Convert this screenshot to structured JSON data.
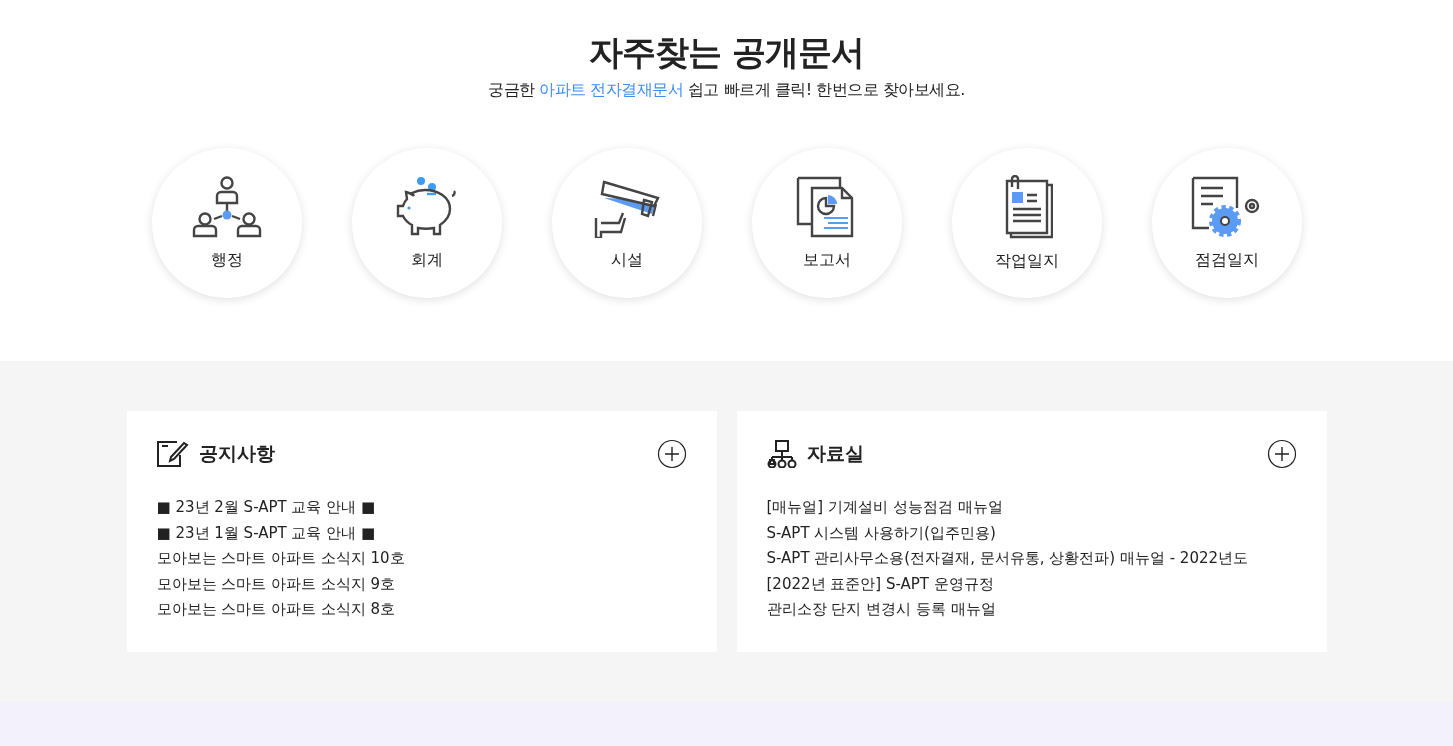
{
  "heading": {
    "title": "자주찾는 공개문서",
    "subtitle": [
      {
        "text": "궁금한 ",
        "highlight": false
      },
      {
        "text": "아파트 전자결재문서",
        "highlight": true
      },
      {
        "text": " 쉽고 빠르게 클릭! 한번으로 찾아보세요.",
        "highlight": false
      }
    ]
  },
  "categories": [
    {
      "label": "행정"
    },
    {
      "label": "회계"
    },
    {
      "label": "시설"
    },
    {
      "label": "보고서"
    },
    {
      "label": "작업일지"
    },
    {
      "label": "점검일지"
    }
  ],
  "boards": [
    {
      "title": "공지사항",
      "items": [
        "■ 23년 2월 S-APT 교육 안내 ■",
        "■ 23년 1월 S-APT 교육 안내 ■",
        "모아보는 스마트 아파트 소식지 10호",
        "모아보는 스마트 아파트 소식지 9호",
        "모아보는 스마트 아파트 소식지 8호"
      ]
    },
    {
      "title": "자료실",
      "items": [
        "[매뉴얼] 기계설비 성능점검 매뉴얼",
        "S-APT 시스템 사용하기(입주민용)",
        "S-APT 관리사무소용(전자결재, 문서유통, 상황전파) 매뉴얼 - 2022년도",
        "[2022년 표준안] S-APT 운영규정",
        "관리소장 단지 변경시 등록 매뉴얼"
      ]
    }
  ]
}
